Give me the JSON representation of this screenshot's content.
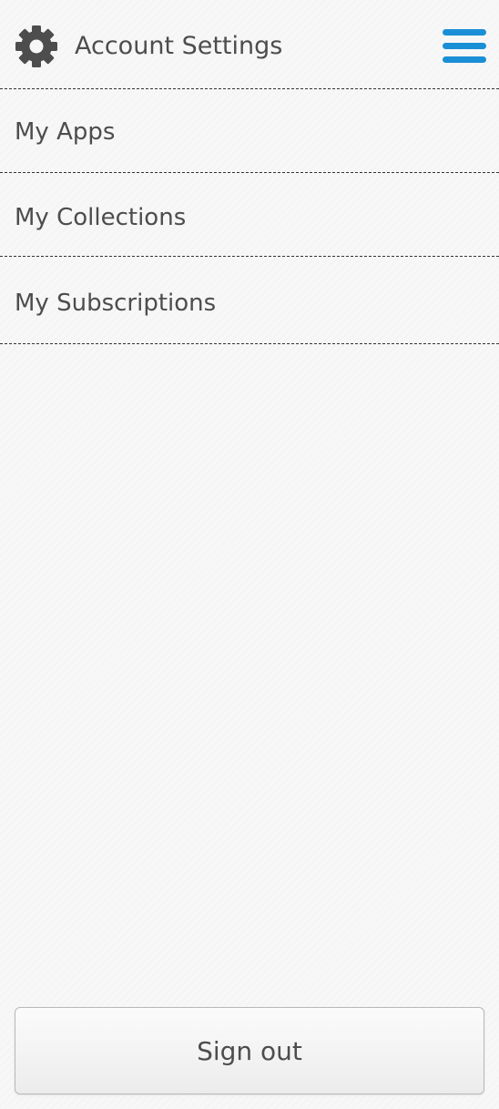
{
  "header": {
    "title": "Account Settings",
    "icon": "gear-icon",
    "menu_icon": "hamburger-menu-icon",
    "menu_color": "#1a8fd6"
  },
  "nav": {
    "items": [
      {
        "label": "My Apps"
      },
      {
        "label": "My Collections"
      },
      {
        "label": "My Subscriptions"
      }
    ]
  },
  "footer": {
    "signout_label": "Sign out"
  }
}
